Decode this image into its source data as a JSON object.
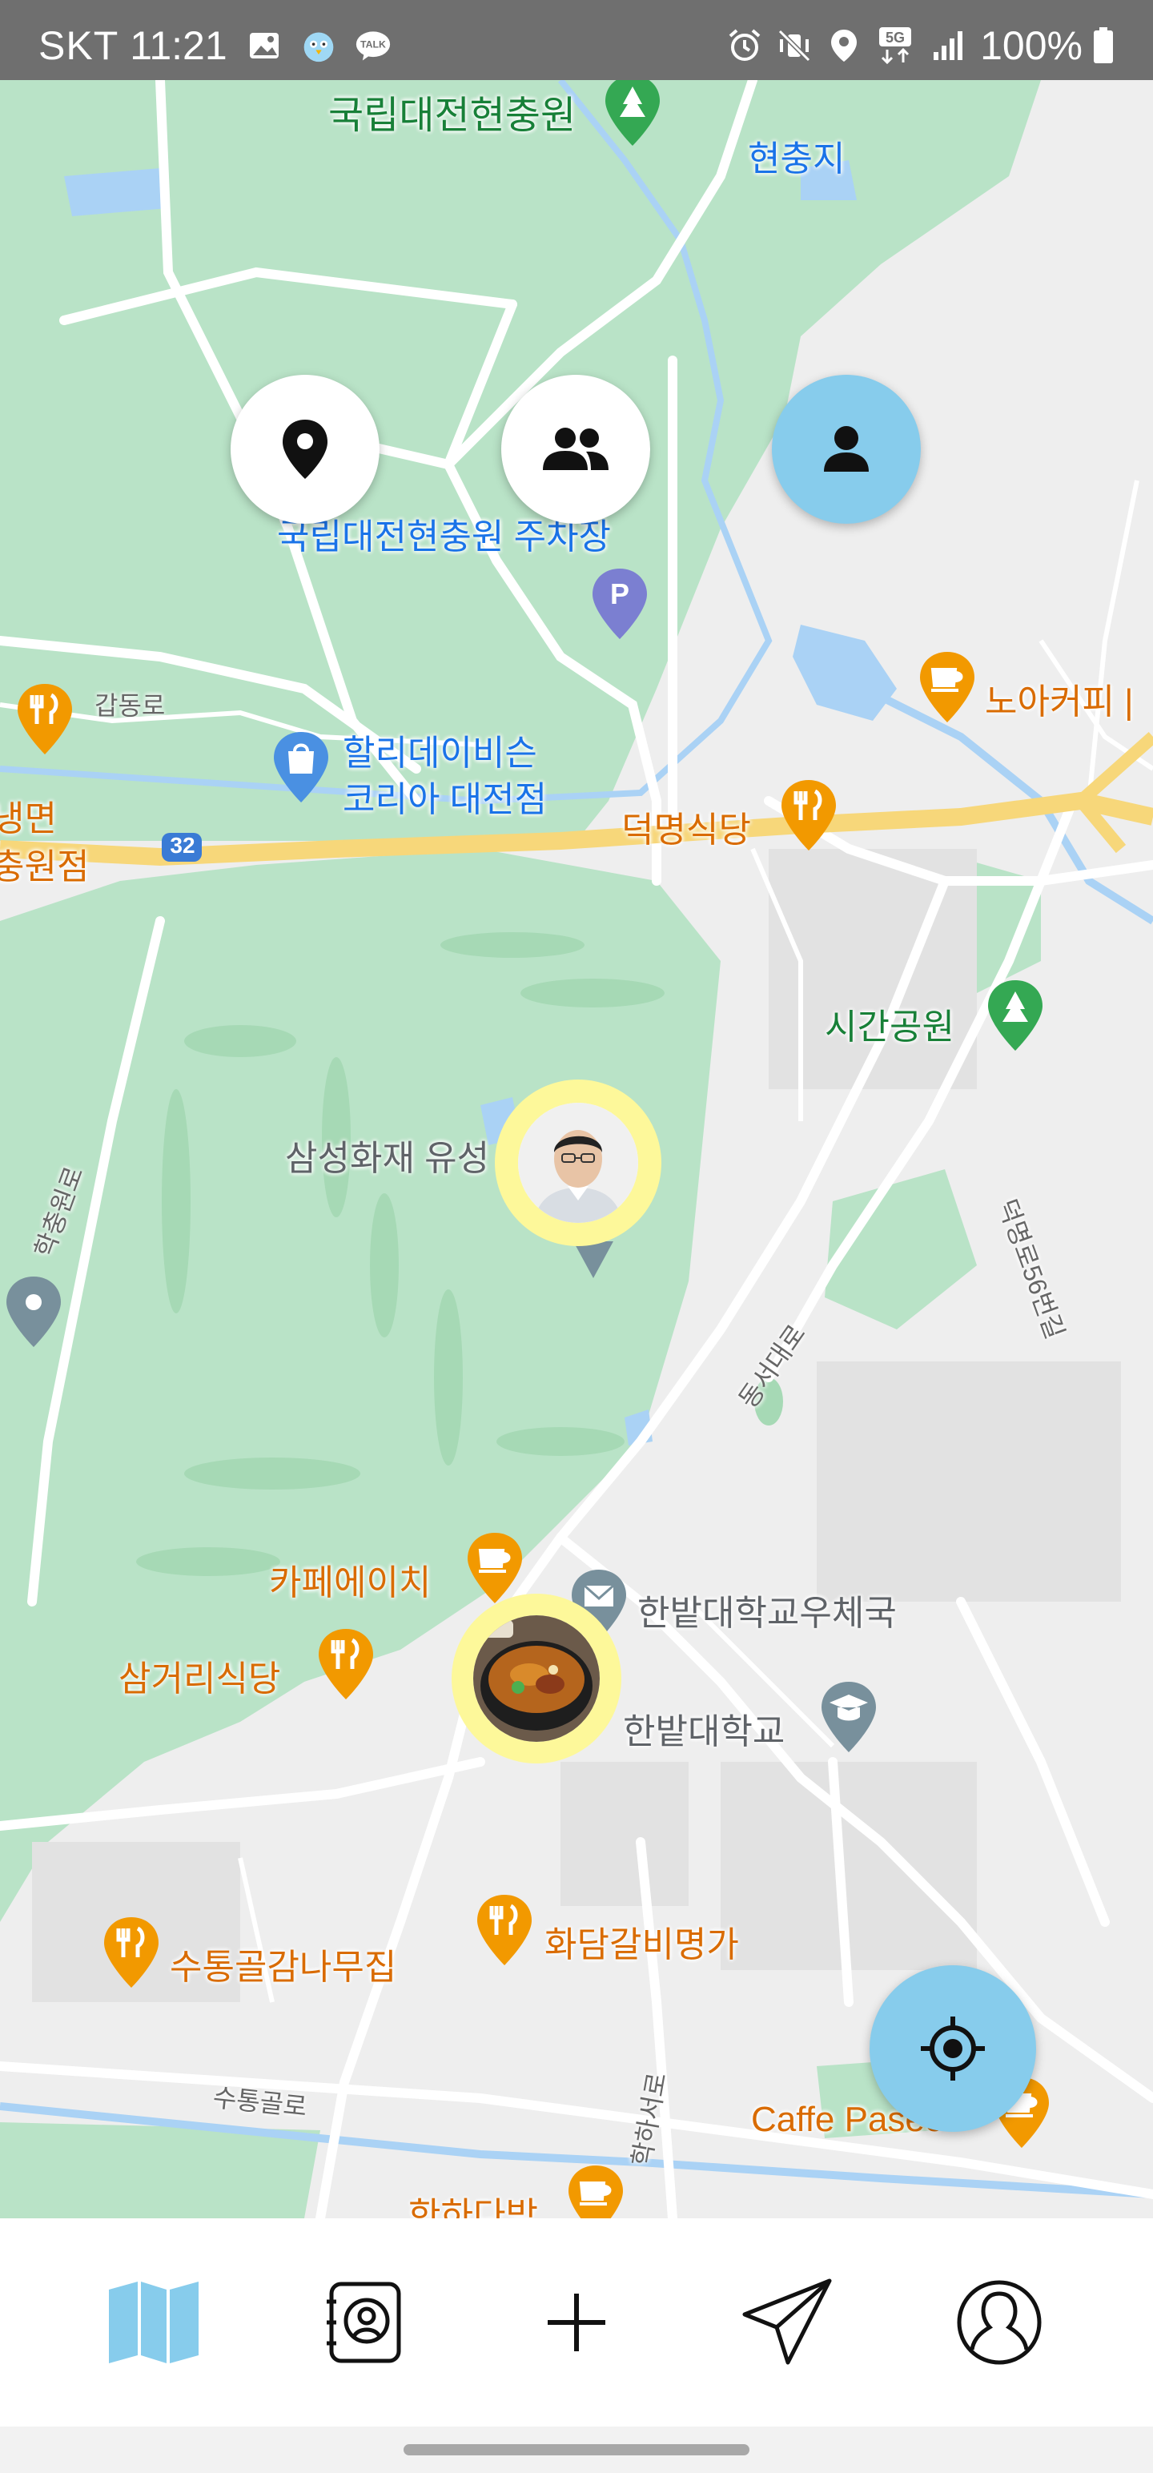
{
  "status_bar": {
    "carrier": "SKT",
    "time": "11:21",
    "network": "5G",
    "battery": "100%"
  },
  "map": {
    "labels": {
      "cemetery": "국립대전현충원",
      "reservoir": "현충지",
      "parking_lot": "국립대전현충원 주차장",
      "gapdong_ro": "갑동로",
      "hollys": "할리데이비슨",
      "hollys_line2": "코리아 대전점",
      "naengmyeon_line1": "냉면",
      "naengmyeon_line2": "충원점",
      "route_32": "32",
      "deokmyeong_restaurant": "덕명식당",
      "noah_coffee": "노아커피 |",
      "sigan_park": "시간공원",
      "samsung_fire": "삼성화재 유성",
      "cafe_h": "카페에이치",
      "hanbat_post": "한밭대학교우체국",
      "samgeori_restaurant": "삼거리식당",
      "hanbat_university": "한밭대학교",
      "sutong_gamnamu": "수통골감나무집",
      "hwadam_galbi": "화담갈비명가",
      "caffe_paseo": "Caffe Paseo",
      "hanha_dabang": "한하다방",
      "sutonggol_ro": "수통골로",
      "hakha_seo_ro": "학하서로",
      "dongseo_daero": "동서대로",
      "deokmyeong_56": "덕명로56번길",
      "hakchung_ro": "학충원로"
    }
  },
  "top_buttons": {
    "place": "location-pin",
    "friends": "people",
    "me": "person"
  },
  "colors": {
    "accent": "#87ccec",
    "marker_halo": "#fdf89a",
    "park_green": "#b9e3c7",
    "water": "#aad2f5",
    "food_orange": "#f29900"
  }
}
